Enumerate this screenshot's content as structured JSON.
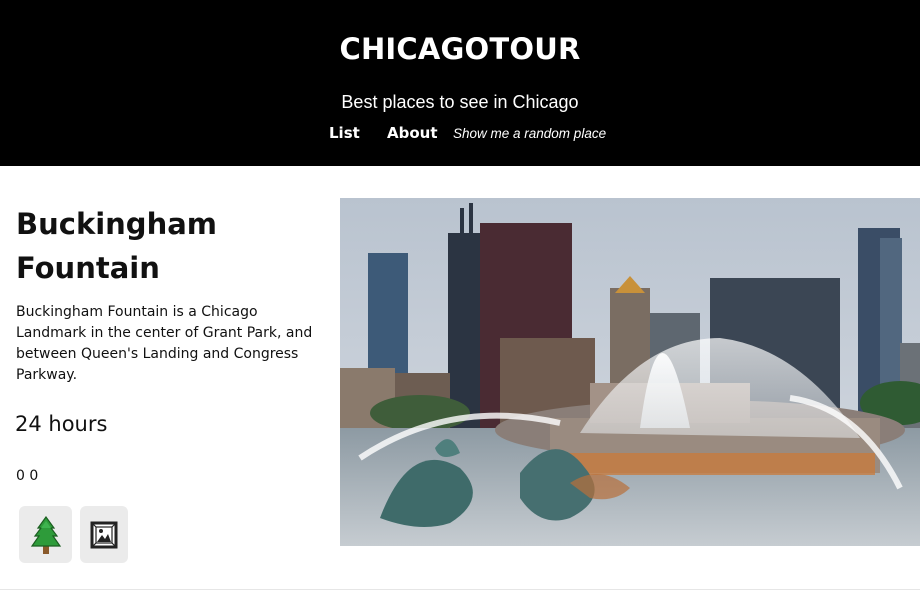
{
  "header": {
    "site_title": "CHICAGOTOUR",
    "tagline": "Best places to see in Chicago",
    "nav": [
      {
        "label": "List"
      },
      {
        "label": "About"
      },
      {
        "label": "Show me a random place"
      }
    ]
  },
  "place": {
    "name": "Buckingham Fountain",
    "description": "Buckingham Fountain is a Chicago Landmark in the center of Grant Park, and between Queen's Landing and Congress Parkway.",
    "hours": "24 hours",
    "counts": "0 0",
    "tags": [
      {
        "icon": "tree-icon"
      },
      {
        "icon": "framed-picture-icon"
      }
    ]
  },
  "colors": {
    "header_bg": "#000000",
    "header_text": "#ffffff",
    "tag_bg": "#ebebeb"
  }
}
